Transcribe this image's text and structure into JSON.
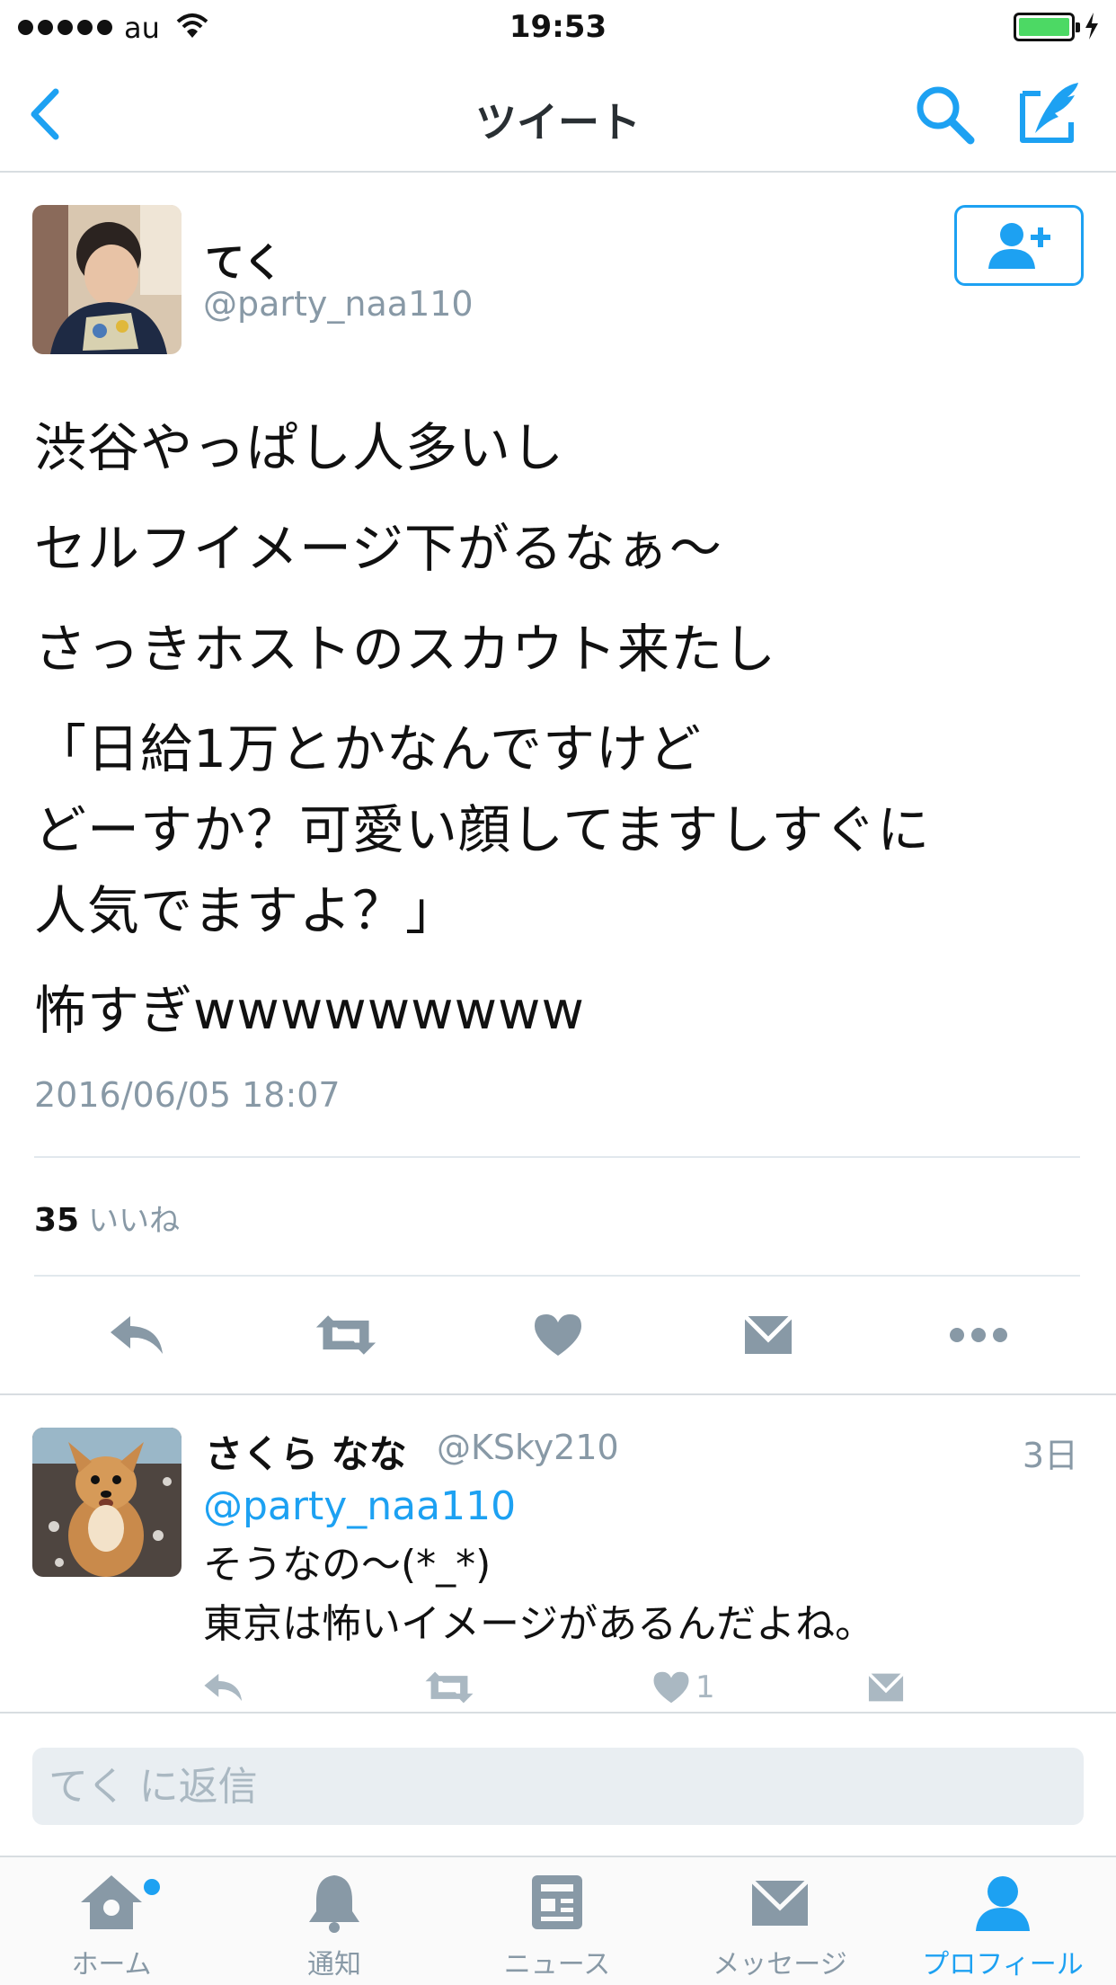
{
  "status_bar": {
    "carrier": "au",
    "time": "19:53",
    "battery_level": 1.0
  },
  "nav": {
    "title": "ツイート",
    "icons": [
      "back-icon",
      "search-icon",
      "compose-icon"
    ]
  },
  "tweet": {
    "author_name": "てく",
    "author_handle": "@party_naa110",
    "lines": [
      "渋谷やっぱし人多いし",
      "セルフイメージ下がるなぁ〜",
      "さっきホストのスカウト来たし",
      "「日給1万とかなんですけど",
      "どーすか？可愛い顔してますしすぐに",
      "人気でますよ？」",
      "怖すぎwwwwwwwww"
    ],
    "timestamp": "2016/06/05 18:07",
    "likes_count": "35",
    "likes_label": "いいね",
    "actions": [
      "reply-icon",
      "retweet-icon",
      "like-icon",
      "message-icon",
      "more-icon"
    ]
  },
  "reply": {
    "name": "さくら なな",
    "handle": "@KSky210",
    "time": "3日",
    "mention": "@party_naa110",
    "lines": [
      "そうなの〜(*_*)",
      "東京は怖いイメージがあるんだよね。"
    ],
    "like_count": "1"
  },
  "reply_input": {
    "placeholder": "てく に返信"
  },
  "tabs": [
    {
      "label": "ホーム",
      "icon": "home-icon",
      "active": false,
      "badge": true
    },
    {
      "label": "通知",
      "icon": "bell-icon",
      "active": false
    },
    {
      "label": "ニュース",
      "icon": "news-icon",
      "active": false
    },
    {
      "label": "メッセージ",
      "icon": "envelope-icon",
      "active": false
    },
    {
      "label": "プロフィール",
      "icon": "profile-icon",
      "active": true
    }
  ],
  "colors": {
    "accent": "#1da1f2",
    "muted": "#8899a6",
    "icon_gray": "#8899a6",
    "battery": "#4cd964"
  }
}
